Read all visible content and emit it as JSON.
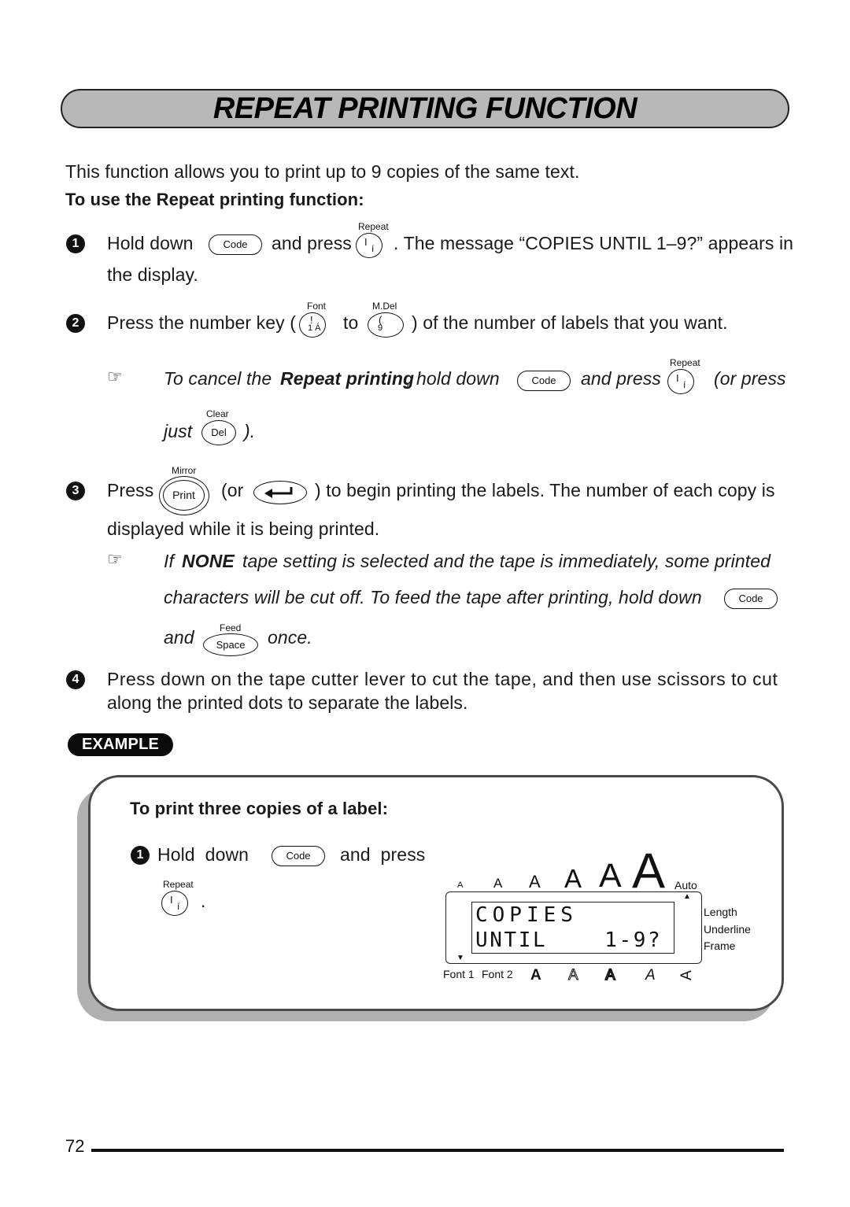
{
  "title": "REPEAT PRINTING FUNCTION",
  "intro": "This function allows you to print up to 9 copies of the same text.",
  "subheading": "To use the Repeat printing function:",
  "keys": {
    "code": "Code",
    "repeat_cap": "Repeat",
    "repeat_main": "I",
    "repeat_sub": "í",
    "font_cap": "Font",
    "font_main": "!",
    "font_sub": "1 Á",
    "mdel_cap": "M.Del",
    "mdel_main": "(",
    "mdel_sub": "9",
    "clear_cap": "Clear",
    "del": "Del",
    "mirror_cap": "Mirror",
    "print": "Print",
    "enter_glyph": "↵",
    "feed_cap": "Feed",
    "space": "Space"
  },
  "steps": [
    {
      "number": "1",
      "parts": [
        "Hold down",
        "and press",
        ". The message “COPIES UNTIL 1–9?” appears in",
        "the display."
      ]
    },
    {
      "number": "2",
      "parts": [
        "Press the number key (",
        "to",
        ") of the number of labels that you want."
      ]
    },
    {
      "number": "3",
      "parts": [
        "Press",
        "(or",
        ") to begin printing the labels. The number of each copy is",
        "displayed while it is being printed."
      ]
    },
    {
      "number": "4",
      "parts": [
        "Press down on the tape cutter lever to cut the tape, and then use scissors to cut",
        "along the printed dots to separate the labels."
      ]
    }
  ],
  "notes": [
    {
      "icon": "hand-pointer-icon",
      "parts": [
        "To cancel the",
        "Repeat printing",
        ", hold down",
        "and press",
        "(or press",
        "just",
        ")."
      ]
    },
    {
      "icon": "hand-pointer-icon",
      "parts": [
        "If",
        "NONE",
        "tape setting is selected and the tape is immediately, some printed",
        "characters will be cut off. To feed the tape after printing, hold down",
        "and",
        "once."
      ]
    }
  ],
  "example": {
    "badge": "EXAMPLE",
    "heading": "To print three copies of a label:",
    "step_number": "1",
    "step_parts": [
      "Hold  down",
      "and  press",
      "."
    ],
    "lcd": {
      "line1": "COPIES",
      "line2": "UNTIL    1-9?",
      "size_glyphs": [
        "A",
        "A",
        "A",
        "A",
        "A",
        "A"
      ],
      "auto_label": "Auto",
      "right_labels": [
        "Length",
        "Underline",
        "Frame"
      ],
      "bottom_labels": [
        "Font 1",
        "Font 2"
      ],
      "style_glyphs": [
        "A",
        "A",
        "A",
        "A",
        "A"
      ],
      "up_arrow": "▲",
      "down_arrow": "▼"
    }
  },
  "page_number": "72"
}
